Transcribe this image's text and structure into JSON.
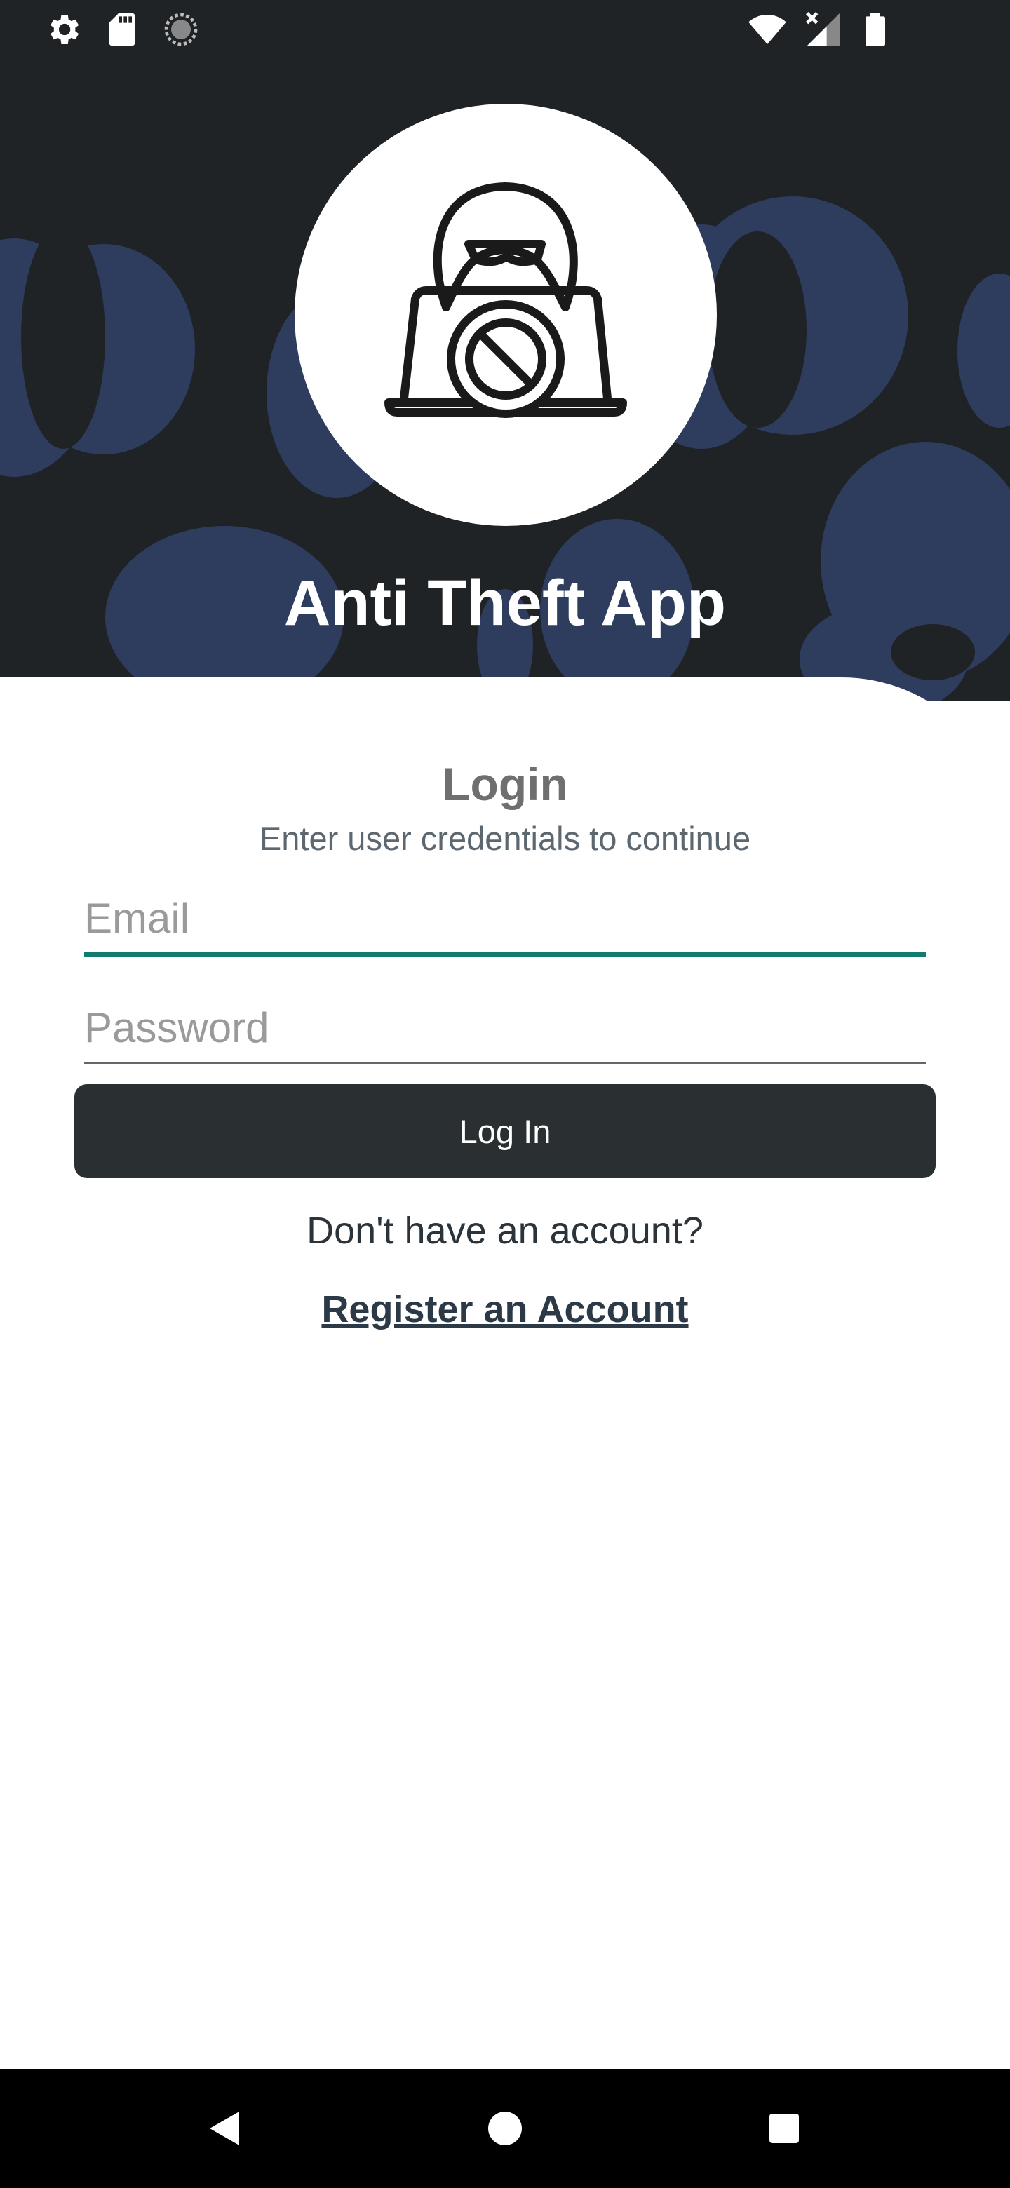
{
  "status_bar": {
    "icons": [
      "settings-icon",
      "sd-card-icon",
      "sync-icon",
      "wifi-icon",
      "signal-no-data-icon",
      "battery-icon"
    ]
  },
  "header": {
    "logo_icon": "hacker-blocked-icon",
    "app_title": "Anti Theft App",
    "background_color": "#1f2326",
    "pattern_color": "#2e3c5e"
  },
  "login": {
    "title": "Login",
    "subtitle": "Enter user credentials to continue",
    "email": {
      "placeholder": "Email",
      "value": ""
    },
    "password": {
      "placeholder": "Password",
      "value": ""
    },
    "login_button": "Log In",
    "no_account_text": "Don't have an account?",
    "register_link": "Register an Account",
    "accent_color": "#127a6e",
    "button_color": "#2a2f31"
  },
  "nav_bar": {
    "icons": [
      "back-icon",
      "home-icon",
      "recents-icon"
    ]
  }
}
